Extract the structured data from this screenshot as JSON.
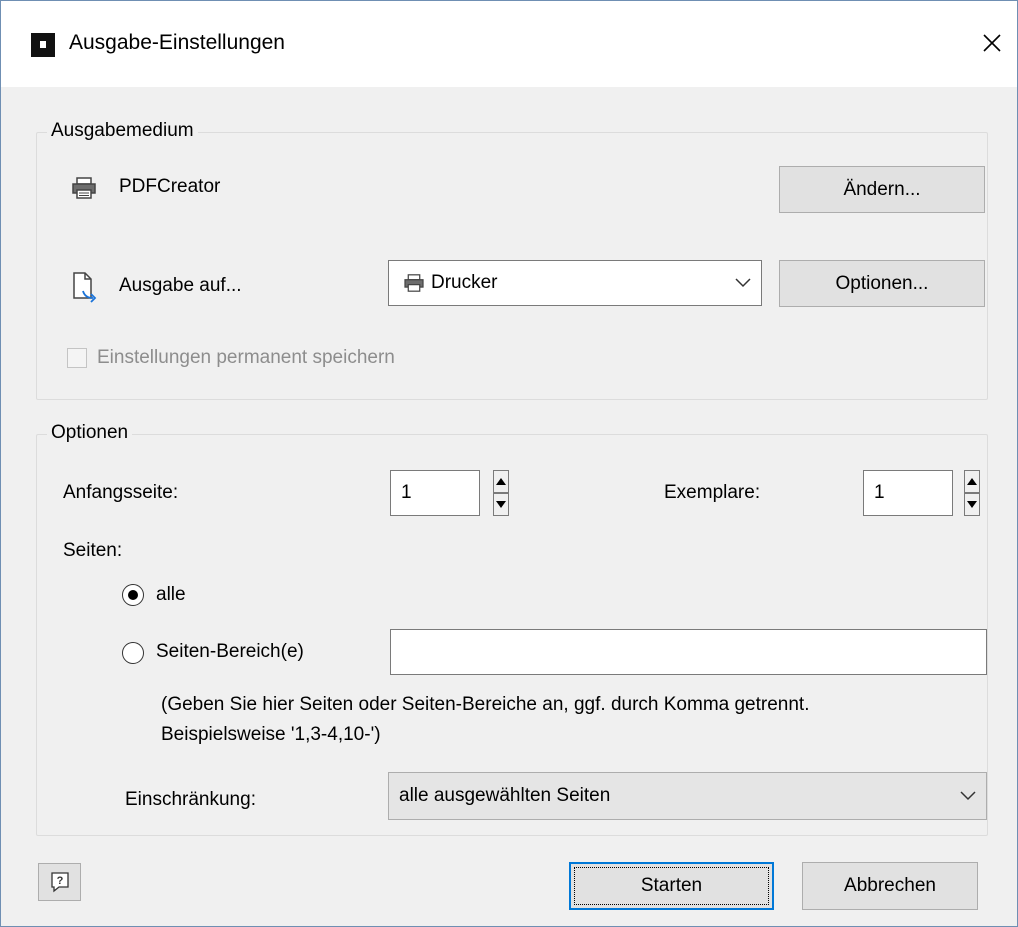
{
  "window": {
    "title": "Ausgabe-Einstellungen",
    "close_symbol": "✕"
  },
  "output_medium": {
    "group_title": "Ausgabemedium",
    "printer_name": "PDFCreator",
    "change_button": "Ändern...",
    "output_to_label": "Ausgabe auf...",
    "output_target": "Drucker",
    "options_button": "Optionen...",
    "permanent_label": "Einstellungen permanent speichern",
    "permanent_checked": false,
    "permanent_enabled": false
  },
  "options": {
    "group_title": "Optionen",
    "start_page_label": "Anfangsseite:",
    "start_page_value": "1",
    "copies_label": "Exemplare:",
    "copies_value": "1",
    "pages_label": "Seiten:",
    "radio_all_label": "alle",
    "radio_range_label": "Seiten-Bereich(e)",
    "selected_radio": "alle",
    "range_value": "",
    "hint_line1": "(Geben Sie hier Seiten oder Seiten-Bereiche an, ggf. durch Komma getrennt.",
    "hint_line2": "Beispielsweise '1,3-4,10-')",
    "restriction_label": "Einschränkung:",
    "restriction_value": "alle ausgewählten Seiten"
  },
  "footer": {
    "help_icon": "help-icon",
    "start_button": "Starten",
    "cancel_button": "Abbrechen"
  },
  "icons": {
    "app": "app-logo-icon",
    "printer": "printer-icon",
    "document_arrow": "document-export-icon",
    "close": "close-icon",
    "chevron": "chevron-down-icon"
  },
  "colors": {
    "window_bg": "#f0f0f0",
    "titlebar_bg": "#ffffff",
    "default_button_border": "#0078d7",
    "disabled_text": "#8d8d8d"
  }
}
